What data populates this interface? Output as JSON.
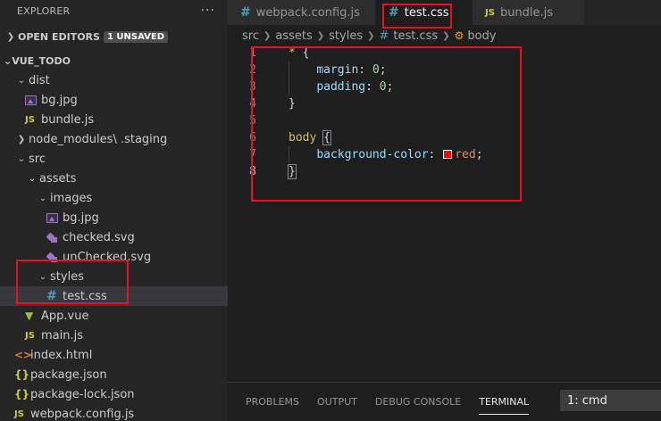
{
  "sidebar": {
    "title": "EXPLORER",
    "more": "···",
    "open_editors": {
      "label": "OPEN EDITORS",
      "badge": "1 UNSAVED"
    },
    "project": "VUE_TODO",
    "tree": [
      {
        "label": "dist",
        "type": "folder",
        "depth": 1,
        "open": true
      },
      {
        "label": "bg.jpg",
        "type": "image",
        "depth": 2
      },
      {
        "label": "bundle.js",
        "type": "js",
        "depth": 2
      },
      {
        "label": "node_modules",
        "suffix": " \\ .staging",
        "type": "folder",
        "depth": 1,
        "open": false
      },
      {
        "label": "src",
        "type": "folder",
        "depth": 1,
        "open": true
      },
      {
        "label": "assets",
        "type": "folder",
        "depth": 2,
        "open": true
      },
      {
        "label": "images",
        "type": "folder",
        "depth": 3,
        "open": true
      },
      {
        "label": "bg.jpg",
        "type": "image",
        "depth": 4
      },
      {
        "label": "checked.svg",
        "type": "svg",
        "depth": 4
      },
      {
        "label": "unChecked.svg",
        "type": "svg",
        "depth": 4
      },
      {
        "label": "styles",
        "type": "folder",
        "depth": 3,
        "open": true
      },
      {
        "label": "test.css",
        "type": "css",
        "depth": 4,
        "selected": true
      },
      {
        "label": "App.vue",
        "type": "vue",
        "depth": 2
      },
      {
        "label": "main.js",
        "type": "js",
        "depth": 2
      },
      {
        "label": "index.html",
        "type": "html",
        "depth": 1
      },
      {
        "label": "package.json",
        "type": "json",
        "depth": 1
      },
      {
        "label": "package-lock.json",
        "type": "json",
        "depth": 1
      },
      {
        "label": "webpack.config.js",
        "type": "js",
        "depth": 1
      }
    ]
  },
  "tabs": [
    {
      "label": "webpack.config.js",
      "icon": "#",
      "active": false
    },
    {
      "label": "test.css",
      "icon": "#",
      "active": true,
      "dirty": true
    },
    {
      "label": "bundle.js",
      "icon": "JS",
      "active": false
    }
  ],
  "breadcrumb": {
    "parts": [
      "src",
      "assets",
      "styles"
    ],
    "file": "test.css",
    "symbol": "body"
  },
  "code": {
    "line_numbers": [
      "1",
      "2",
      "3",
      "4",
      "5",
      "6",
      "7",
      "8"
    ],
    "l1_sel": "*",
    "l1_brace": "{",
    "l2_prop": "margin",
    "l2_val": "0",
    "l3_prop": "padding",
    "l3_val": "0",
    "l4_brace": "}",
    "l6_sel": "body",
    "l6_brace": "{",
    "l7_prop": "background-color",
    "l7_val": "red",
    "l8_brace": "}"
  },
  "panel": {
    "tabs": [
      "PROBLEMS",
      "OUTPUT",
      "DEBUG CONSOLE",
      "TERMINAL"
    ],
    "terminal_select": "1: cmd"
  },
  "icons": {
    "js": "JS",
    "css": "#",
    "json": "{}",
    "html": "<>",
    "vue": "▼"
  },
  "colors": {
    "highlight": "#e81123",
    "swatch": "#ff0000"
  }
}
